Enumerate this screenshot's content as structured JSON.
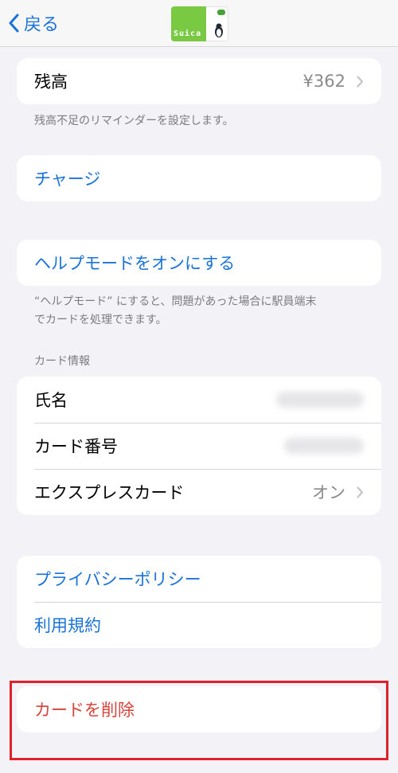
{
  "navbar": {
    "back_label": "戻る",
    "card_brand": "Suica"
  },
  "balance": {
    "label": "残高",
    "value": "¥362",
    "note": "残高不足のリマインダーを設定します。"
  },
  "charge": {
    "label": "チャージ"
  },
  "help": {
    "label": "ヘルプモードをオンにする",
    "note_line1": "“ヘルプモード” にすると、問題があった場合に駅員端末",
    "note_line2": "でカードを処理できます。"
  },
  "card_info": {
    "header": "カード情報",
    "name_label": "氏名",
    "number_label": "カード番号",
    "express_label": "エクスプレスカード",
    "express_value": "オン"
  },
  "legal": {
    "privacy": "プライバシーポリシー",
    "terms": "利用規約"
  },
  "remove": {
    "label": "カードを削除"
  },
  "colors": {
    "accent": "#1a73d9",
    "danger": "#d8433a",
    "highlight": "#e0202a",
    "suica_green": "#7ac943"
  }
}
